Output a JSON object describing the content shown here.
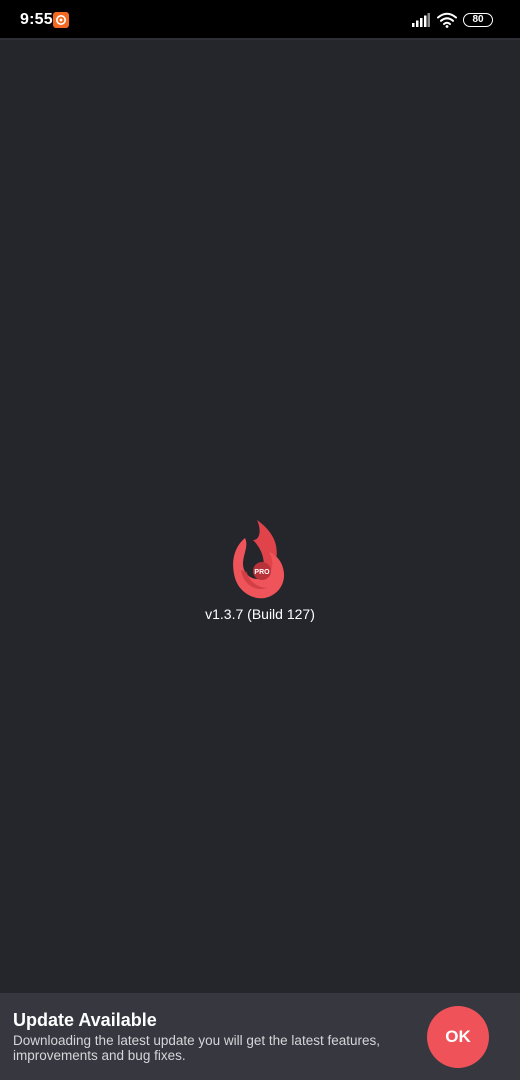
{
  "status_bar": {
    "time": "9:55",
    "battery": "80",
    "icons": [
      "notification-app-icon",
      "signal-icon",
      "wifi-icon",
      "battery-icon"
    ]
  },
  "splash": {
    "logo_badge": "PRO",
    "version": "v1.3.7 (Build 127)"
  },
  "update_banner": {
    "title": "Update Available",
    "message": "Downloading the latest update you will get the latest features, improvements and bug fixes.",
    "ok_label": "OK"
  },
  "colors": {
    "background": "#25262c",
    "status_bar": "#000000",
    "banner": "#36373f",
    "accent": "#ef5259",
    "notification_icon": "#f26a21"
  }
}
